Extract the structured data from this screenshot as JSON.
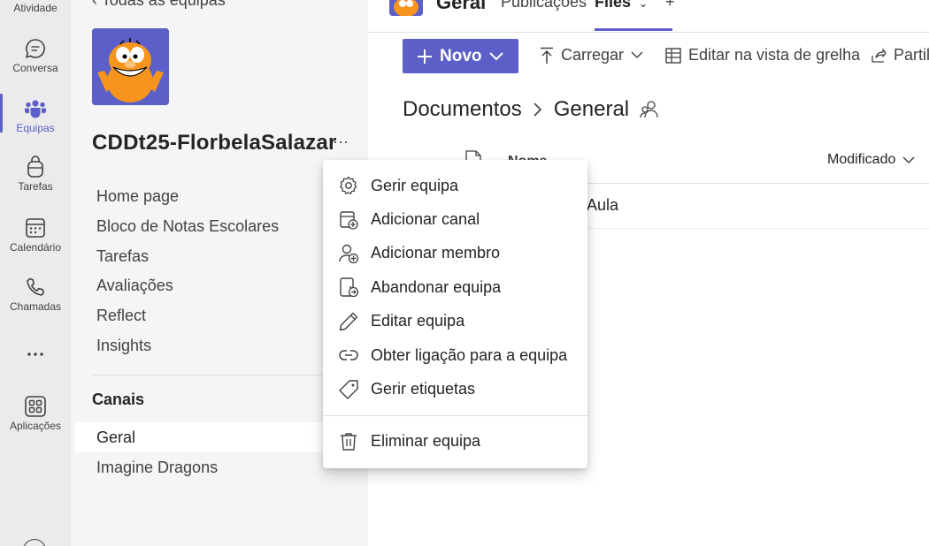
{
  "rail": {
    "items": [
      {
        "id": "atividade",
        "label": "Atividade",
        "icon": "bell-icon"
      },
      {
        "id": "conversa",
        "label": "Conversa",
        "icon": "chat-icon"
      },
      {
        "id": "equipas",
        "label": "Equipas",
        "icon": "teams-icon",
        "active": true
      },
      {
        "id": "tarefas",
        "label": "Tarefas",
        "icon": "tasks-icon"
      },
      {
        "id": "calendario",
        "label": "Calendário",
        "icon": "calendar-icon"
      },
      {
        "id": "chamadas",
        "label": "Chamadas",
        "icon": "phone-icon"
      },
      {
        "id": "mais",
        "label": "",
        "icon": "more-icon"
      },
      {
        "id": "aplicacoes",
        "label": "Aplicações",
        "icon": "apps-icon"
      }
    ]
  },
  "team": {
    "back_label": "Todas as equipas",
    "name": "CDDt25-FlorbelaSalazar",
    "more_glyph": "···",
    "nav": [
      "Home page",
      "Bloco de Notas Escolares",
      "Tarefas",
      "Avaliações",
      "Reflect",
      "Insights"
    ],
    "channels_title": "Canais",
    "channels": [
      "Geral",
      "Imagine Dragons"
    ]
  },
  "header": {
    "channel_title": "Geral",
    "tabs": [
      "Publicações",
      "Files",
      "+"
    ]
  },
  "commands": {
    "new_label": "Novo",
    "upload_label": "Carregar",
    "grid_label": "Editar na vista de grelha",
    "share_label": "Partilhar"
  },
  "breadcrumb": {
    "root": "Documentos",
    "current": "General"
  },
  "file_list": {
    "col_name": "Nome",
    "col_modified": "Modificado",
    "rows": [
      "Aula"
    ]
  },
  "context_menu": {
    "items": [
      {
        "label": "Gerir equipa",
        "icon": "gear-icon"
      },
      {
        "label": "Adicionar canal",
        "icon": "add-channel-icon"
      },
      {
        "label": "Adicionar membro",
        "icon": "add-member-icon"
      },
      {
        "label": "Abandonar equipa",
        "icon": "leave-team-icon"
      },
      {
        "label": "Editar equipa",
        "icon": "pencil-icon"
      },
      {
        "label": "Obter ligação para a equipa",
        "icon": "link-icon"
      },
      {
        "label": "Gerir etiquetas",
        "icon": "tag-icon"
      }
    ],
    "danger_item": {
      "label": "Eliminar equipa",
      "icon": "trash-icon"
    }
  },
  "colors": {
    "accent": "#5b5fc7",
    "rail_bg": "#ebebeb",
    "panel_bg": "#f5f5f5"
  }
}
